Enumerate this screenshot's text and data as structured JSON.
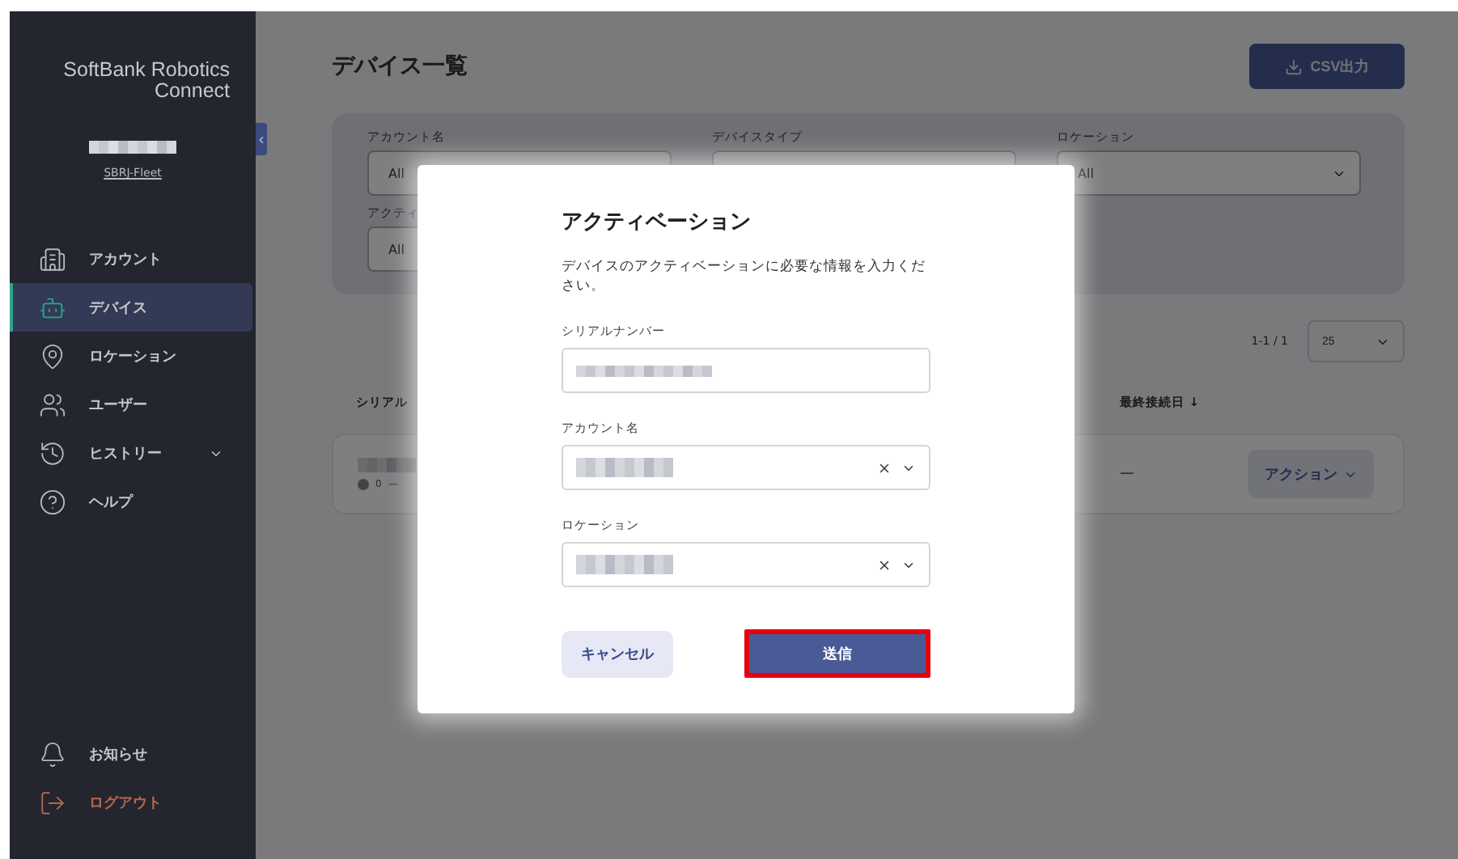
{
  "sidebar": {
    "brand": [
      "SoftBank Robotics",
      "Connect"
    ],
    "org_link": "SBRJ-Fleet",
    "nav": [
      {
        "kind": "account",
        "label": "アカウント",
        "selected": false,
        "expandable": false
      },
      {
        "kind": "device",
        "label": "デバイス",
        "selected": true,
        "expandable": false
      },
      {
        "kind": "location",
        "label": "ロケーション",
        "selected": false,
        "expandable": false
      },
      {
        "kind": "user",
        "label": "ユーザー",
        "selected": false,
        "expandable": false
      },
      {
        "kind": "history",
        "label": "ヒストリー",
        "selected": false,
        "expandable": true
      },
      {
        "kind": "help",
        "label": "ヘルプ",
        "selected": false,
        "expandable": false
      }
    ],
    "footer": [
      {
        "kind": "notice",
        "label": "お知らせ"
      },
      {
        "kind": "logout",
        "label": "ログアウト"
      }
    ]
  },
  "page": {
    "title": "デバイス一覧",
    "export_button": "CSV出力",
    "filters": [
      {
        "label": "アカウント名",
        "value": "All"
      },
      {
        "label": "デバイスタイプ"
      },
      {
        "label": "ロケーション",
        "value": "All",
        "chevron": true
      },
      {
        "label": "アクティ",
        "value": "All"
      }
    ],
    "pagination": "1-1 / 1",
    "page_size": "25",
    "columns": [
      "シリアル",
      "最終接続日 ↓"
    ],
    "rows": [
      {
        "status": "0",
        "status_text": "—",
        "last_connected": "—",
        "action": "アクション"
      }
    ]
  },
  "modal": {
    "title": "アクティベーション",
    "description": "デバイスのアクティベーションに必要な情報を入力ください。",
    "fields": [
      {
        "kind": "text",
        "label": "シリアルナンバー"
      },
      {
        "kind": "select",
        "label": "アカウント名"
      },
      {
        "kind": "select",
        "label": "ロケーション"
      }
    ],
    "cancel": "キャンセル",
    "submit": "送信",
    "submit_highlighted": true
  }
}
